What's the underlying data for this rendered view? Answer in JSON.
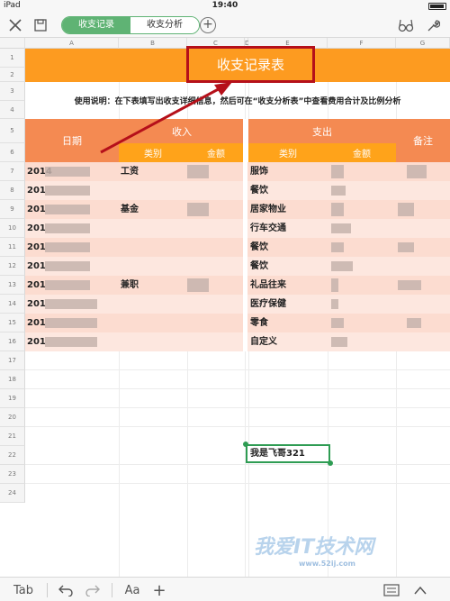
{
  "status": {
    "carrier": "iPad",
    "time": "19:40"
  },
  "toolbar": {
    "tabs": [
      {
        "label": "收支记录",
        "active": true
      },
      {
        "label": "收支分析",
        "active": false
      }
    ],
    "add_label": "+"
  },
  "sheet": {
    "columns": [
      "A",
      "B",
      "C",
      "D",
      "E",
      "F",
      "G"
    ],
    "rows": [
      "1",
      "2",
      "3",
      "4",
      "5",
      "6",
      "7",
      "8",
      "9",
      "10",
      "11",
      "12",
      "13",
      "14",
      "15",
      "16",
      "17",
      "18",
      "19",
      "20",
      "21",
      "22",
      "23",
      "24"
    ],
    "title": "收支记录表",
    "instructions": "使用说明：在下表填写出收支详细信息，然后可在“收支分析表”中查看费用合计及比例分析",
    "headers": {
      "date": "日期",
      "income": "收入",
      "expense": "支出",
      "note": "备注",
      "income_cat": "类别",
      "income_amt": "金额",
      "expense_cat": "类别",
      "expense_amt": "金额"
    },
    "data_rows": [
      {
        "date": "2014",
        "income_cat": "工资",
        "expense_cat": "服饰"
      },
      {
        "date": "201",
        "income_cat": "",
        "expense_cat": "餐饮"
      },
      {
        "date": "201",
        "income_cat": "基金",
        "expense_cat": "居家物业"
      },
      {
        "date": "201",
        "income_cat": "",
        "expense_cat": "行车交通"
      },
      {
        "date": "201",
        "income_cat": "",
        "expense_cat": "餐饮"
      },
      {
        "date": "201",
        "income_cat": "",
        "expense_cat": "餐饮"
      },
      {
        "date": "201",
        "income_cat": "兼职",
        "expense_cat": "礼品往来"
      },
      {
        "date": "201",
        "income_cat": "",
        "expense_cat": "医疗保健"
      },
      {
        "date": "201",
        "income_cat": "",
        "expense_cat": "零食"
      },
      {
        "date": "201",
        "income_cat": "",
        "expense_cat": "自定义"
      }
    ],
    "selected_cell_value": "我是飞哥321"
  },
  "bottombar": {
    "tab_label": "Tab",
    "font_label": "Aa",
    "add_label": "+"
  },
  "watermark": {
    "text": "我爱IT技术网",
    "url": "www.52ij.com"
  },
  "colors": {
    "accent": "#5fb374",
    "title_band": "#fd9b20",
    "header": "#f48a52",
    "subheader": "#ffa31a",
    "annotation": "#b5101a"
  }
}
